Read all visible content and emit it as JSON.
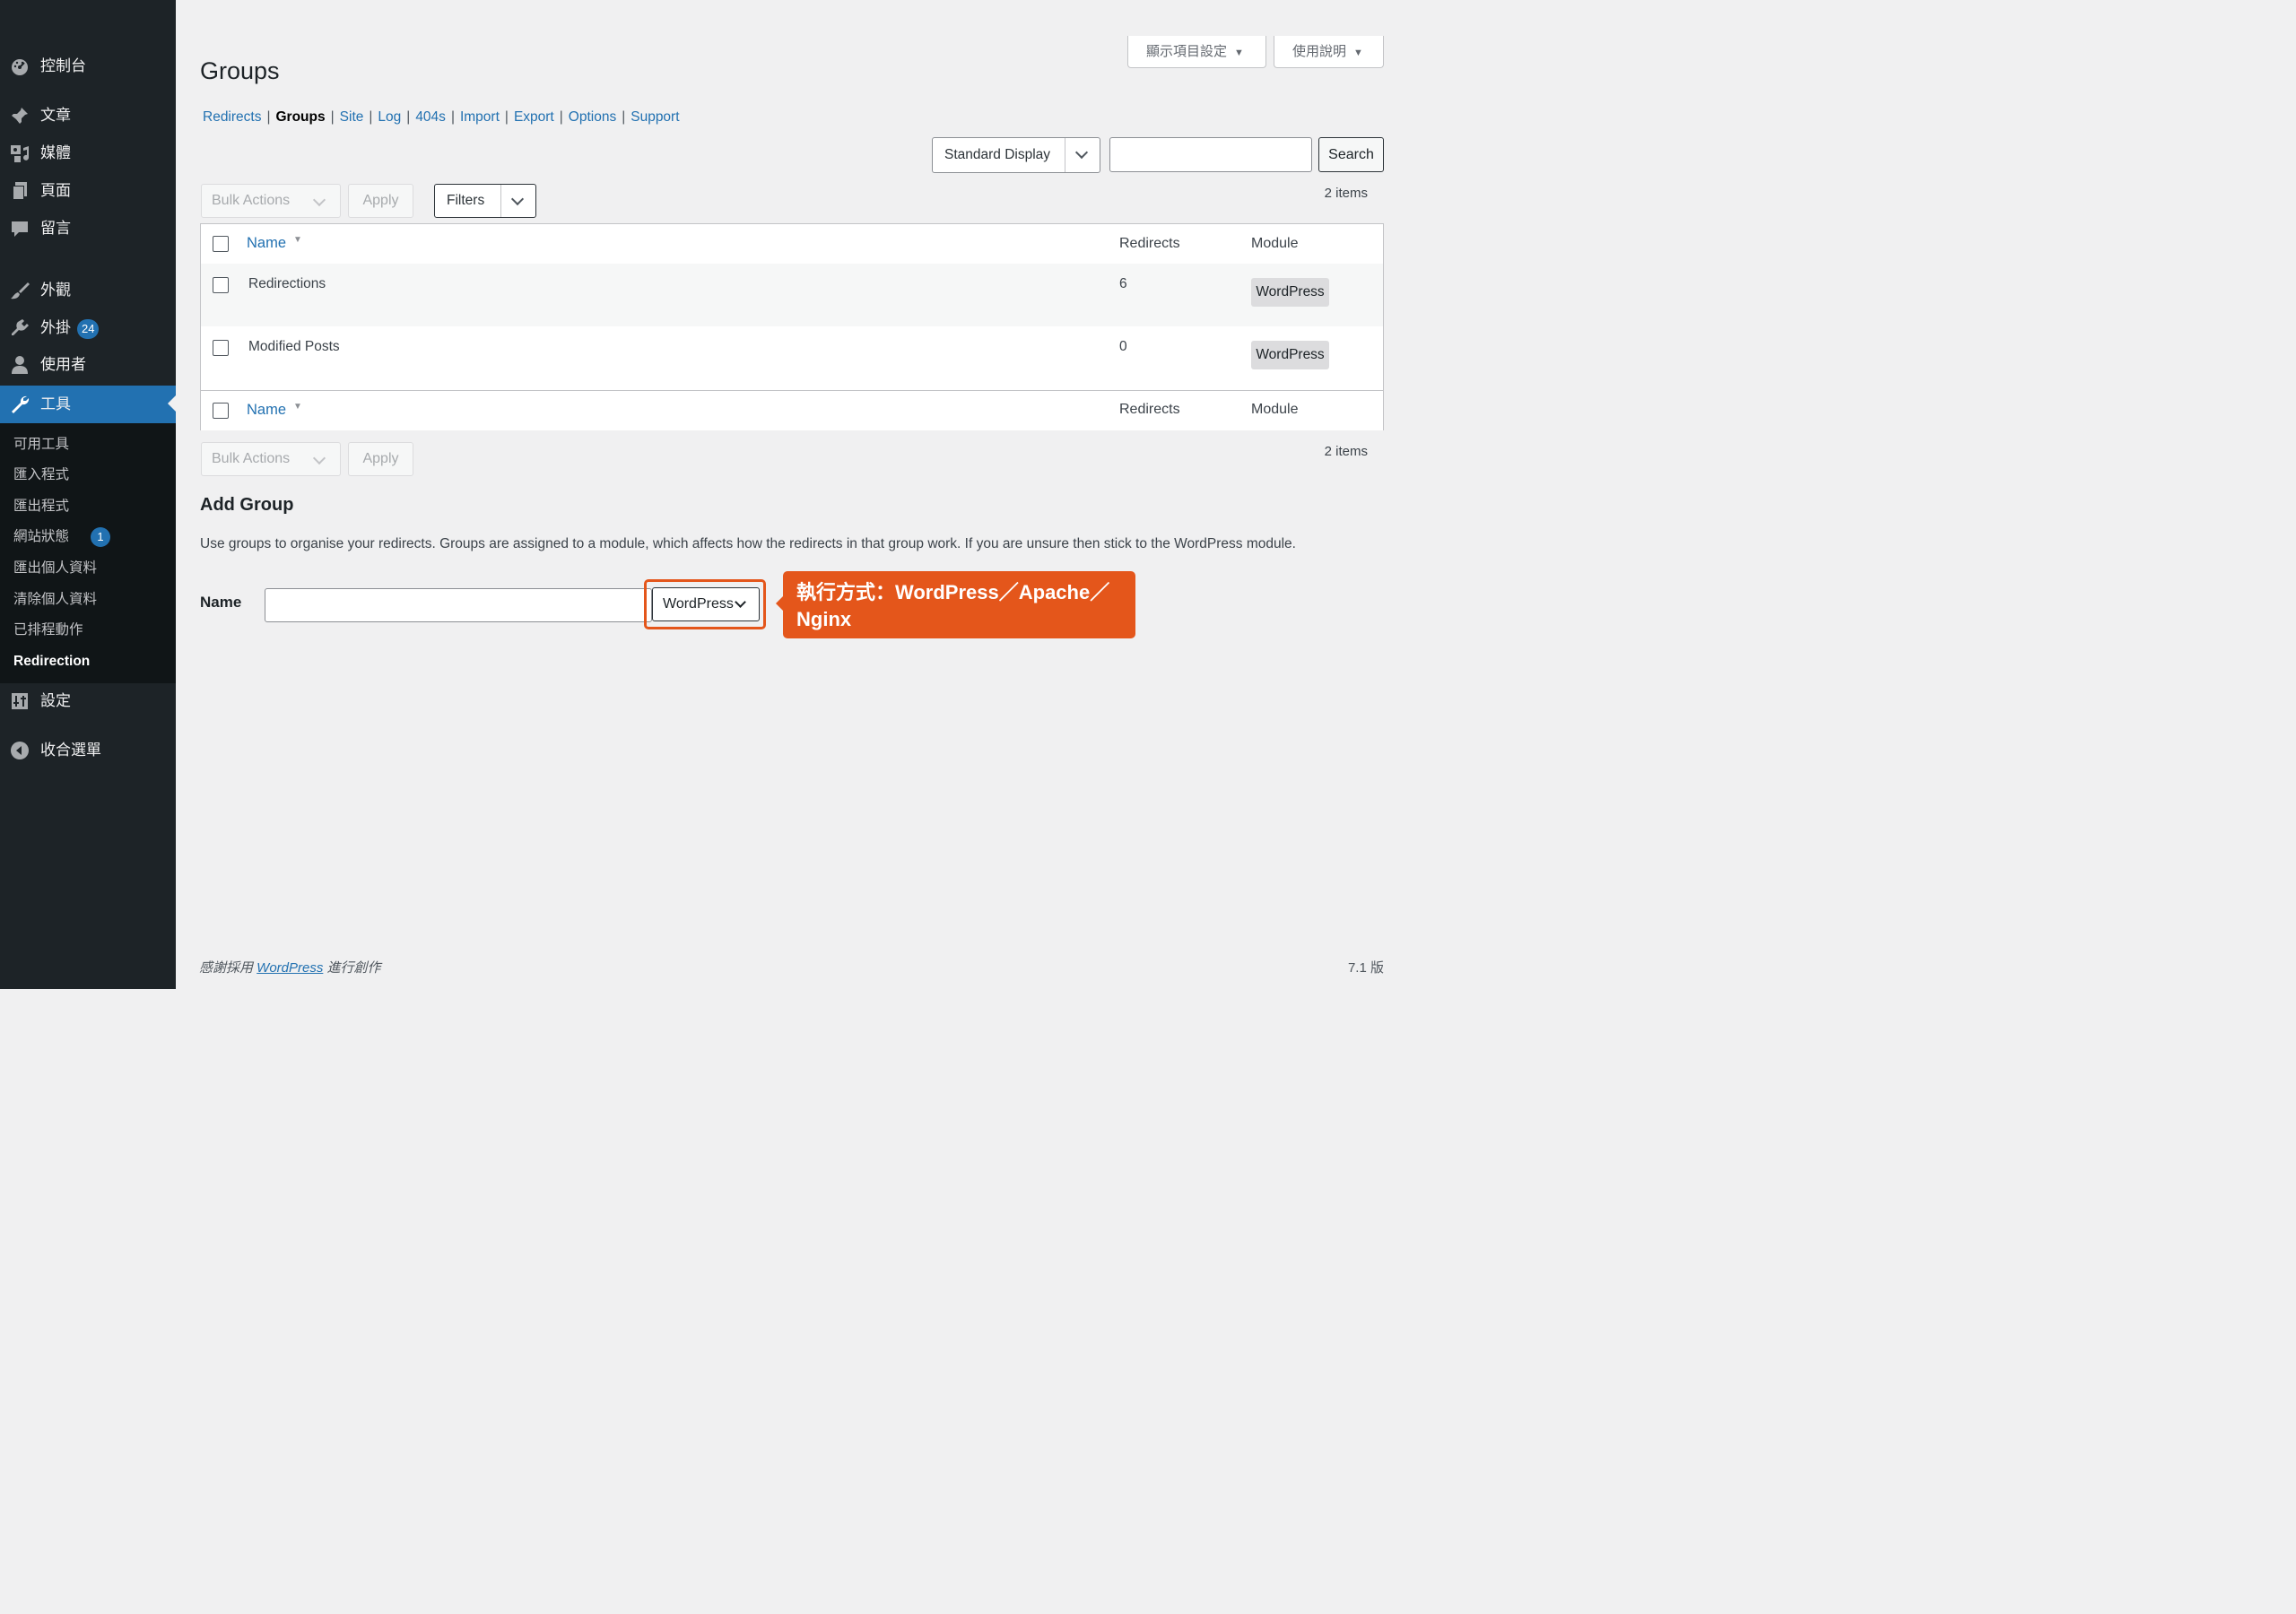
{
  "sidebar": {
    "items": [
      {
        "label": "控制台",
        "icon": "dashboard-icon"
      },
      {
        "label": "文章",
        "icon": "pin-icon"
      },
      {
        "label": "媒體",
        "icon": "media-icon"
      },
      {
        "label": "頁面",
        "icon": "pages-icon"
      },
      {
        "label": "留言",
        "icon": "comment-icon"
      },
      {
        "label": "外觀",
        "icon": "brush-icon"
      },
      {
        "label": "外掛",
        "icon": "plugin-icon",
        "badge": "24"
      },
      {
        "label": "使用者",
        "icon": "user-icon"
      },
      {
        "label": "工具",
        "icon": "wrench-icon",
        "active": true
      },
      {
        "label": "設定",
        "icon": "settings-icon"
      },
      {
        "label": "收合選單",
        "icon": "collapse-icon"
      }
    ],
    "submenu": [
      {
        "label": "可用工具"
      },
      {
        "label": "匯入程式"
      },
      {
        "label": "匯出程式"
      },
      {
        "label": "網站狀態",
        "badge": "1"
      },
      {
        "label": "匯出個人資料"
      },
      {
        "label": "清除個人資料"
      },
      {
        "label": "已排程動作"
      },
      {
        "label": "Redirection",
        "current": true
      }
    ]
  },
  "header": {
    "screen_options": "顯示項目設定",
    "help": "使用說明",
    "title": "Groups"
  },
  "subnav": [
    "Redirects",
    "Groups",
    "Site",
    "Log",
    "404s",
    "Import",
    "Export",
    "Options",
    "Support"
  ],
  "subnav_current": "Groups",
  "toolbar": {
    "display_select": "Standard Display",
    "search_placeholder": "",
    "search_button": "Search",
    "bulk_actions": "Bulk Actions",
    "apply": "Apply",
    "filters": "Filters",
    "count": "2 items"
  },
  "table": {
    "columns": {
      "name": "Name",
      "redirects": "Redirects",
      "module": "Module"
    },
    "rows": [
      {
        "name": "Redirections",
        "redirects": "6",
        "module": "WordPress"
      },
      {
        "name": "Modified Posts",
        "redirects": "0",
        "module": "WordPress"
      }
    ]
  },
  "add_group": {
    "heading": "Add Group",
    "description": "Use groups to organise your redirects. Groups are assigned to a module, which affects how the redirects in that group work. If you are unsure then stick to the WordPress module.",
    "name_label": "Name",
    "name_value": "",
    "module_selected": "WordPress",
    "callout_line1": "執行方式：WordPress／Apache／",
    "callout_line2": "Nginx"
  },
  "footer": {
    "thanks_prefix": "感謝採用 ",
    "thanks_link": "WordPress",
    "thanks_suffix": " 進行創作",
    "version": "7.1 版"
  },
  "colors": {
    "accent": "#2271b1",
    "sidebar": "#1d2327",
    "callout": "#e4561b"
  }
}
